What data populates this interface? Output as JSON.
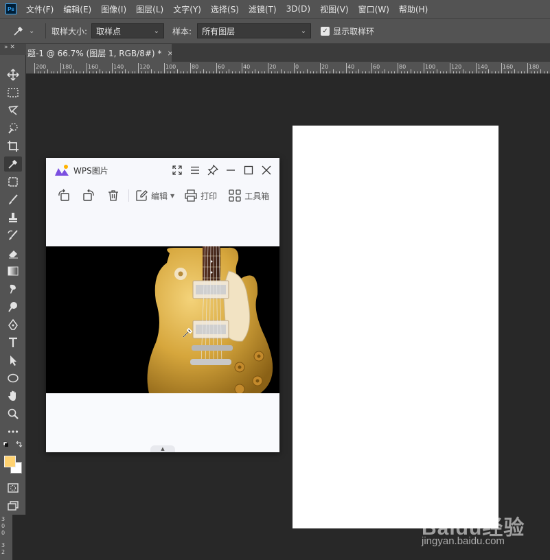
{
  "app": {
    "logo_text": "Ps"
  },
  "menu": [
    "文件(F)",
    "编辑(E)",
    "图像(I)",
    "图层(L)",
    "文字(Y)",
    "选择(S)",
    "滤镜(T)",
    "3D(D)",
    "视图(V)",
    "窗口(W)",
    "帮助(H)"
  ],
  "options": {
    "sample_size_label": "取样大小:",
    "sample_size_value": "取样点",
    "sample_label": "样本:",
    "sample_value": "所有图层",
    "show_ring_label": "显示取样环",
    "show_ring_checked": true
  },
  "document_tab": {
    "title": "题-1 @ 66.7% (图层 1, RGB/8#) *",
    "close": "×"
  },
  "ruler_top_ticks": [
    "200",
    "180",
    "160",
    "140",
    "120",
    "100",
    "80",
    "60",
    "40",
    "20",
    "0",
    "20",
    "40",
    "60",
    "80",
    "100",
    "120",
    "140",
    "160",
    "180"
  ],
  "ruler_left_ticks": [
    "3",
    "0",
    "0",
    "3",
    "2"
  ],
  "toolbar": {
    "grip": "»  ✕"
  },
  "colors": {
    "foreground": "#ffd270",
    "background": "#ffffff",
    "canvas": "#282828",
    "panel": "#535353"
  },
  "wps": {
    "title": "WPS图片",
    "tools": {
      "edit": "编辑",
      "print": "打印",
      "toolbox": "工具箱"
    }
  },
  "watermark": {
    "brand": "Baidu经验",
    "url": "jingyan.baidu.com"
  }
}
